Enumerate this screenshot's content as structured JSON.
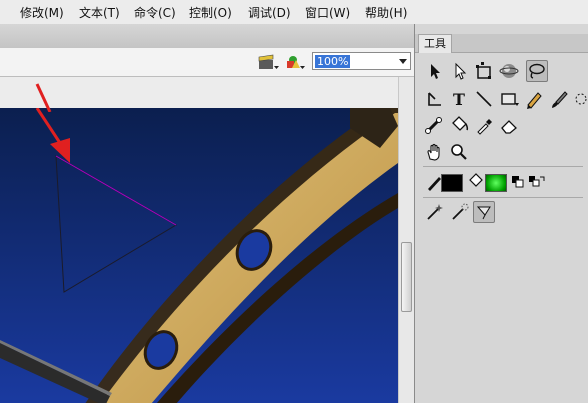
{
  "menu": [
    "修改(M)",
    "文本(T)",
    "命令(C)",
    "控制(O)",
    "调试(D)",
    "窗口(W)",
    "帮助(H)"
  ],
  "toolbar": {
    "zoom_value": "100%",
    "edit_scene_icon": "clapperboard-icon",
    "edit_symbol_icon": "shapes-icon"
  },
  "tools_panel": {
    "title": "工具",
    "text_tool_glyph": "T",
    "tools": [
      "selection",
      "subselection",
      "free-transform",
      "3d-rotation",
      "lasso",
      "pen",
      "text",
      "line",
      "rectangle",
      "pencil",
      "brush",
      "deco",
      "bone",
      "paint-bucket",
      "eyedropper",
      "eraser",
      "hand",
      "zoom",
      "stroke-color",
      "fill-color",
      "black-and-white",
      "swap-colors",
      "snap",
      "smooth",
      "straighten"
    ],
    "active_tool": "lasso",
    "stroke_color": "#000000",
    "fill_color": "#00b000"
  },
  "colors": {
    "stage_top": "#0b1f4f",
    "stage_bottom": "#1a3aa0",
    "arc": "#d8b76a",
    "arrow": "#e02020",
    "triangle_edge": "#b000c0"
  }
}
